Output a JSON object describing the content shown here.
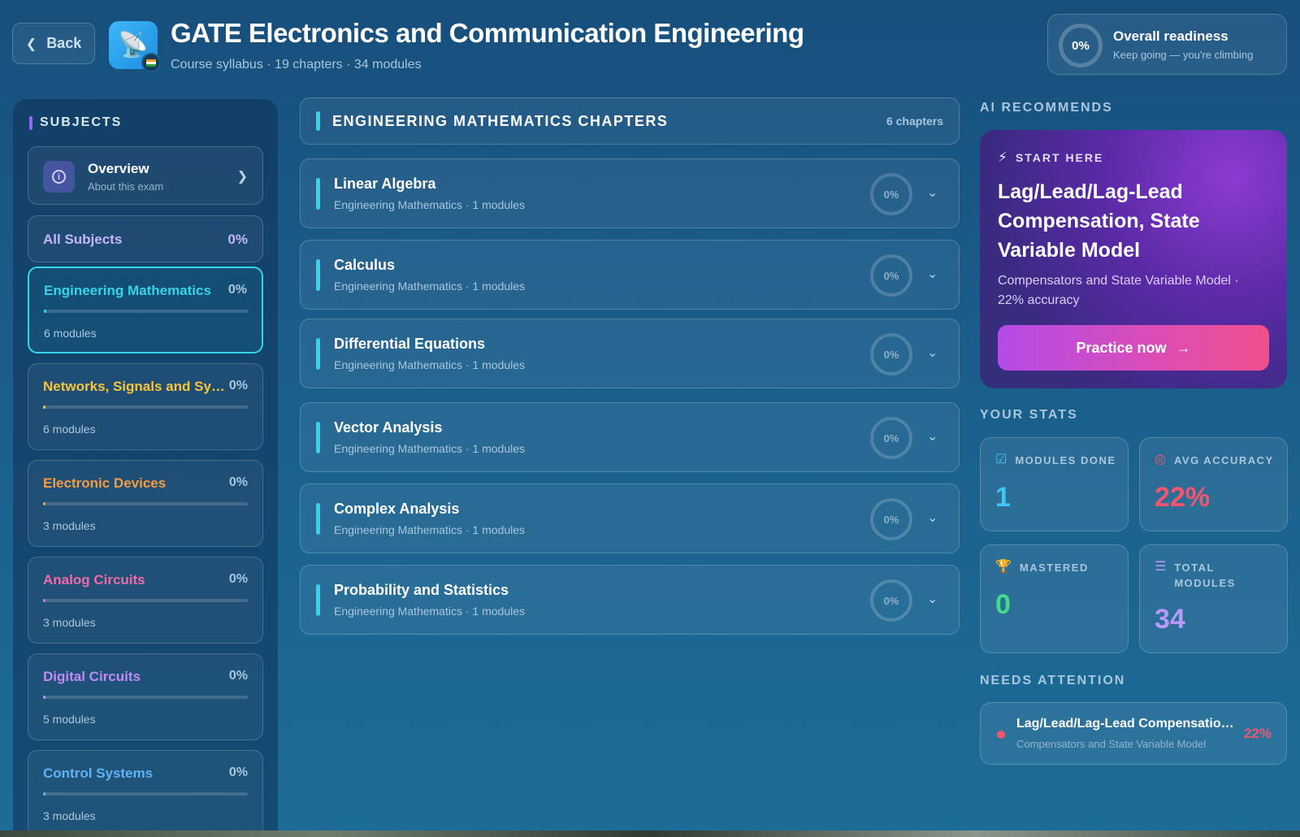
{
  "header": {
    "back_label": "Back",
    "title": "GATE Electronics and Communication Engineering",
    "subtitle": "Course syllabus · 19 chapters · 34 modules",
    "logo_icon": "satellite-dish-icon",
    "flag_icon": "india-flag-icon"
  },
  "readiness": {
    "percent": "0%",
    "title": "Overall readiness",
    "subtitle": "Keep going — you're climbing"
  },
  "sidebar": {
    "heading": "SUBJECTS",
    "overview": {
      "title": "Overview",
      "subtitle": "About this exam"
    },
    "all_subjects": {
      "label": "All Subjects",
      "percent": "0%"
    },
    "subjects": [
      {
        "name": "Engineering Mathematics",
        "percent": "0%",
        "progress": 0,
        "modules": "6 modules",
        "color": "#36d4e8",
        "active": true
      },
      {
        "name": "Networks, Signals and Systems",
        "percent": "0%",
        "progress": 0,
        "modules": "6 modules",
        "color": "#f7c43b",
        "active": false
      },
      {
        "name": "Electronic Devices",
        "percent": "0%",
        "progress": 0,
        "modules": "3 modules",
        "color": "#f59a3e",
        "active": false
      },
      {
        "name": "Analog Circuits",
        "percent": "0%",
        "progress": 0,
        "modules": "3 modules",
        "color": "#f26aa8",
        "active": false
      },
      {
        "name": "Digital Circuits",
        "percent": "0%",
        "progress": 0,
        "modules": "5 modules",
        "color": "#c08af5",
        "active": false
      },
      {
        "name": "Control Systems",
        "percent": "0%",
        "progress": 0,
        "modules": "3 modules",
        "color": "#5fb2f5",
        "active": false
      }
    ]
  },
  "main": {
    "heading": "ENGINEERING MATHEMATICS CHAPTERS",
    "count": "6 chapters",
    "chapters": [
      {
        "title": "Linear Algebra",
        "subtitle": "Engineering Mathematics · 1 modules",
        "percent": "0%"
      },
      {
        "title": "Calculus",
        "subtitle": "Engineering Mathematics · 1 modules",
        "percent": "0%"
      },
      {
        "title": "Differential Equations",
        "subtitle": "Engineering Mathematics · 1 modules",
        "percent": "0%"
      },
      {
        "title": "Vector Analysis",
        "subtitle": "Engineering Mathematics · 1 modules",
        "percent": "0%"
      },
      {
        "title": "Complex Analysis",
        "subtitle": "Engineering Mathematics · 1 modules",
        "percent": "0%"
      },
      {
        "title": "Probability and Statistics",
        "subtitle": "Engineering Mathematics · 1 modules",
        "percent": "0%"
      }
    ]
  },
  "recommend": {
    "heading": "AI RECOMMENDS",
    "tag": "START HERE",
    "title": "Lag/Lead/Lag-Lead Compensation, State Variable Model",
    "description": "Compensators and State Variable Model · 22% accuracy",
    "button_label": "Practice now"
  },
  "stats": {
    "heading": "YOUR STATS",
    "modules_done": {
      "label": "MODULES DONE",
      "value": "1",
      "color": "#3ec7f2"
    },
    "avg_accuracy": {
      "label": "AVG ACCURACY",
      "value": "22%",
      "color": "#f2566f"
    },
    "mastered": {
      "label": "MASTERED",
      "value": "0",
      "color": "#46d98a"
    },
    "total_modules": {
      "label": "TOTAL MODULES",
      "value": "34",
      "color": "#b79af7"
    }
  },
  "attention": {
    "heading": "NEEDS ATTENTION",
    "items": [
      {
        "title": "Lag/Lead/Lag-Lead Compensation, State Variable Model",
        "subtitle": "Compensators and State Variable Model",
        "percent": "22%"
      }
    ]
  }
}
